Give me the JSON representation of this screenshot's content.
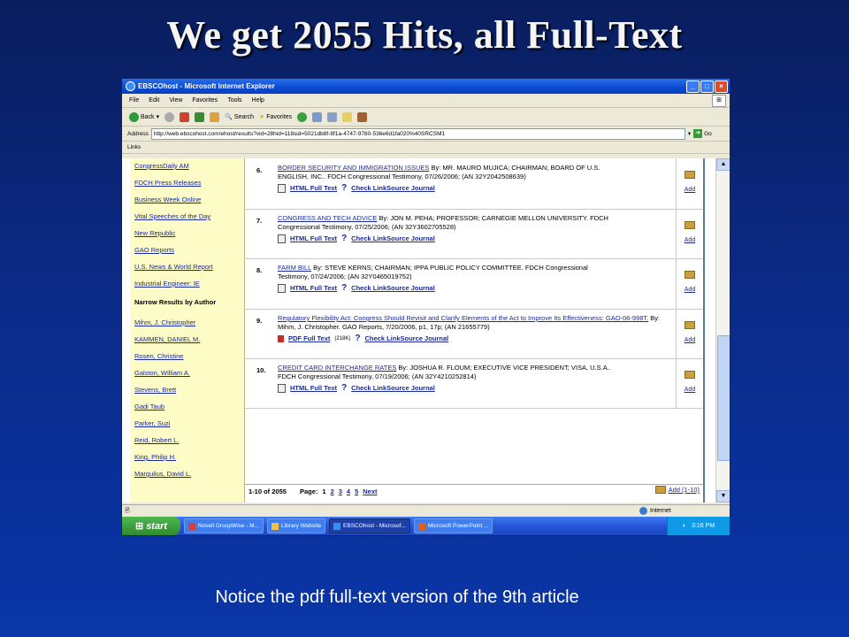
{
  "slide": {
    "title": "We get 2055 Hits, all Full-Text",
    "caption": "Notice the pdf full-text version of the 9th article"
  },
  "browser": {
    "window_title": "EBSCOhost - Microsoft Internet Explorer",
    "menu": [
      "File",
      "Edit",
      "View",
      "Favorites",
      "Tools",
      "Help"
    ],
    "toolbar": {
      "back": "Back",
      "search": "Search",
      "favorites": "Favorites"
    },
    "address_label": "Address",
    "address_value": "http://web.ebscohost.com/ehost/results?vid=28hid=118sid=5021db8f-8f1a-4747-9780-536e6d1fa020%40SRCSM1",
    "go_label": "Go",
    "links_label": "Links"
  },
  "sidebar": {
    "sources": [
      "CongressDaily AM",
      "FDCH Press Releases",
      "Business Week Online",
      "Vital Speeches of the Day",
      "New Republic",
      "GAO Reports",
      "U.S. News & World Report",
      "Industrial Engineer: IE"
    ],
    "author_heading": "Narrow Results by Author",
    "authors": [
      "Mihm, J. Christopher",
      "KAMMEN, DANIEL M.",
      "Rosen, Christine",
      "Galston, William A.",
      "Stevens, Brett",
      "Gadi Taub",
      "Parker, Suzi",
      "Reid, Robert L.",
      "King, Philip H.",
      "Margulius, David L."
    ]
  },
  "results": [
    {
      "num": "6.",
      "title": "BORDER SECURITY AND IMMIGRATION ISSUES",
      "line1": " By: MR. MAURO MUJICA; CHAIRMAN; BOARD OF U.S.",
      "line2": "ENGLISH, INC.. FDCH Congressional Testimony, 07/26/2006; (AN 32Y2042508639)",
      "fulltext": "HTML Full Text",
      "extra": "",
      "linksource": "Check LinkSource Journal",
      "add": "Add"
    },
    {
      "num": "7.",
      "title": "CONGRESS AND TECH ADVICE",
      "line1": " By: JON M. PEHA; PROFESSOR; CARNEGIE MELLON UNIVERSITY. FDCH",
      "line2": "Congressional Testimony, 07/25/2006; (AN 32Y3602705528)",
      "fulltext": "HTML Full Text",
      "extra": "",
      "linksource": "Check LinkSource Journal",
      "add": "Add"
    },
    {
      "num": "8.",
      "title": "FARM BILL",
      "line1": " By: STEVE KERNS; CHAIRMAN; IPPA PUBLIC POLICY COMMITTEE. FDCH Congressional",
      "line2": "Testimony, 07/24/2006; (AN 32Y0465019752)",
      "fulltext": "HTML Full Text",
      "extra": "",
      "linksource": "Check LinkSource Journal",
      "add": "Add"
    },
    {
      "num": "9.",
      "title": "Regulatory Flexibility Act: Congress Should Revisit and Clarify Elements of the Act to Improve Its Effectiveness: GAO-06-998T.",
      "line1": " By: Mihm, J. Christopher. GAO Reports, 7/20/2006, p1, 17p; (AN 21655779)",
      "line2": "",
      "fulltext": "PDF Full Text",
      "extra": "(218K)",
      "linksource": "Check LinkSource Journal",
      "add": "Add"
    },
    {
      "num": "10.",
      "title": "CREDIT CARD INTERCHANGE RATES",
      "line1": " By: JOSHUA R. FLOUM; EXECUTIVE VICE PRESIDENT; VISA, U.S.A..",
      "line2": "FDCH Congressional Testimony, 07/19/2006; (AN 32Y4210252814)",
      "fulltext": "HTML Full Text",
      "extra": "",
      "linksource": "Check LinkSource Journal",
      "add": "Add"
    }
  ],
  "pager": {
    "range": "1-10 of 2055",
    "page_label": "Page:",
    "pages": [
      "1",
      "2",
      "3",
      "4",
      "5"
    ],
    "next": "Next",
    "add_range": "Add (1-10)"
  },
  "status": {
    "zone": "Internet"
  },
  "taskbar": {
    "start": "start",
    "tasks": [
      "Novell GroupWise - M...",
      "Library Website",
      "EBSCOhost - Microsof...",
      "Microsoft PowerPoint ..."
    ],
    "active_task": "EBSCOhost - Microsof...",
    "clock": "3:16 PM"
  }
}
